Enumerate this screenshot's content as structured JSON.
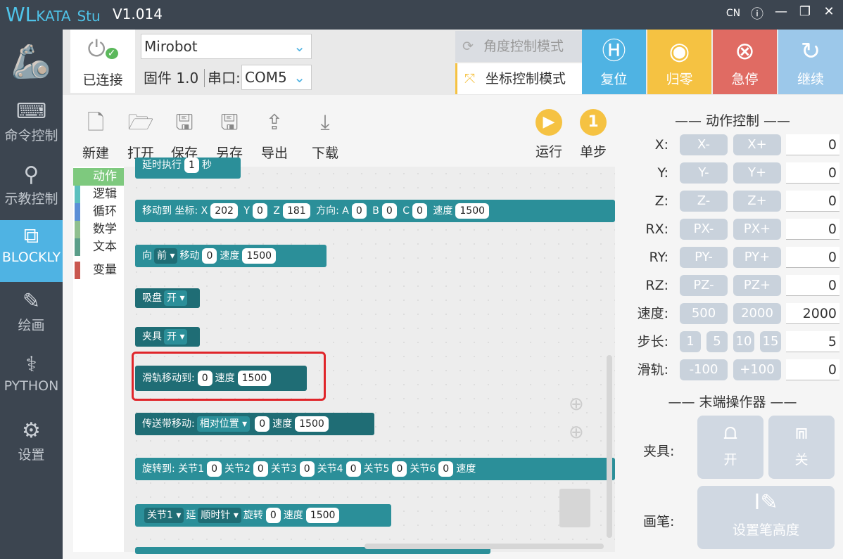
{
  "title": {
    "brand": "WL",
    "brand2": "KATA",
    "brand3": "Stu",
    "version": "V1.014",
    "lang": "CN"
  },
  "sidebar": [
    {
      "label": "命令控制",
      "icon": "terminal-icon"
    },
    {
      "label": "示教控制",
      "icon": "teach-icon"
    },
    {
      "label": "BLOCKLY",
      "icon": "puzzle-icon"
    },
    {
      "label": "绘画",
      "icon": "brush-icon"
    },
    {
      "label": "PYTHON",
      "icon": "python-icon"
    },
    {
      "label": "设置",
      "icon": "gear-icon"
    }
  ],
  "connection": {
    "status": "已连接",
    "device": "Mirobot",
    "firmware": "固件 1.0",
    "port_label": "串口:",
    "port": "COM5"
  },
  "modes": {
    "angle": "角度控制模式",
    "coord": "坐标控制模式"
  },
  "actions": {
    "reset": "复位",
    "zero": "归零",
    "estop": "急停",
    "resume": "继续"
  },
  "colors": {
    "reset": "#4fb3e3",
    "zero": "#f5c242",
    "estop": "#e06b63",
    "resume": "#9cc8ea"
  },
  "toolbar": {
    "new": "新建",
    "open": "打开",
    "save": "保存",
    "saveas": "另存",
    "export": "导出",
    "download": "下载",
    "run": "运行",
    "step": "单步",
    "step_num": "1"
  },
  "categories": [
    {
      "label": "动作",
      "color": "#7ec97e"
    },
    {
      "label": "逻辑",
      "color": "#5bc0be"
    },
    {
      "label": "循环",
      "color": "#5b8fd6"
    },
    {
      "label": "数学",
      "color": "#8fbf8f"
    },
    {
      "label": "文本",
      "color": "#5b9e8a"
    },
    {
      "label": "变量",
      "color": "#c9574f"
    }
  ],
  "blocks": {
    "top_partial": {
      "label": "延时执行",
      "value": "1",
      "unit": "秒"
    },
    "move_to": {
      "label": "移动到 坐标:",
      "x": "202",
      "y": "0",
      "z": "181",
      "dir": "方向:",
      "a": "0",
      "b": "0",
      "c": "0",
      "speed_label": "速度",
      "speed": "1500"
    },
    "move_dir": {
      "label": "向",
      "dir": "前",
      "move": "移动",
      "value": "0",
      "speed_label": "速度",
      "speed": "1500"
    },
    "suction": {
      "label": "吸盘",
      "state": "开"
    },
    "gripper": {
      "label": "夹具",
      "state": "开"
    },
    "rail": {
      "label": "滑轨移动到:",
      "value": "0",
      "speed_label": "速度",
      "speed": "1500"
    },
    "conveyor": {
      "label": "传送带移动:",
      "mode": "相对位置",
      "value": "0",
      "speed_label": "速度",
      "speed": "1500"
    },
    "rotate": {
      "label": "旋转到: 关节1",
      "j1": "0",
      "l2": "关节2",
      "j2": "0",
      "l3": "关节3",
      "j3": "0",
      "l4": "关节4",
      "j4": "0",
      "l5": "关节5",
      "j5": "0",
      "l6": "关节6",
      "j6": "0",
      "speed_label": "速度"
    },
    "joint": {
      "joint": "关节1",
      "along": "延",
      "direction": "顺时针",
      "rotate": "旋转",
      "value": "0",
      "speed_label": "速度",
      "speed": "1500"
    }
  },
  "motion": {
    "title": "—— 动作控制 ——",
    "rows": [
      {
        "label": "X:",
        "minus": "X-",
        "plus": "X+",
        "value": "0"
      },
      {
        "label": "Y:",
        "minus": "Y-",
        "plus": "Y+",
        "value": "0"
      },
      {
        "label": "Z:",
        "minus": "Z-",
        "plus": "Z+",
        "value": "0"
      },
      {
        "label": "RX:",
        "minus": "PX-",
        "plus": "PX+",
        "value": "0"
      },
      {
        "label": "RY:",
        "minus": "PY-",
        "plus": "PY+",
        "value": "0"
      },
      {
        "label": "RZ:",
        "minus": "PZ-",
        "plus": "PZ+",
        "value": "0"
      }
    ],
    "speed": {
      "label": "速度:",
      "a": "500",
      "b": "2000",
      "value": "2000"
    },
    "step": {
      "label": "步长:",
      "s1": "1",
      "s2": "5",
      "s3": "10",
      "s4": "15",
      "value": "5"
    },
    "rail": {
      "label": "滑轨:",
      "minus": "-100",
      "plus": "+100",
      "value": "0"
    }
  },
  "effector": {
    "title": "—— 末端操作器 ——",
    "gripper": "夹具:",
    "open": "开",
    "close": "关",
    "pen": "画笔:",
    "pen_height": "设置笔高度"
  }
}
